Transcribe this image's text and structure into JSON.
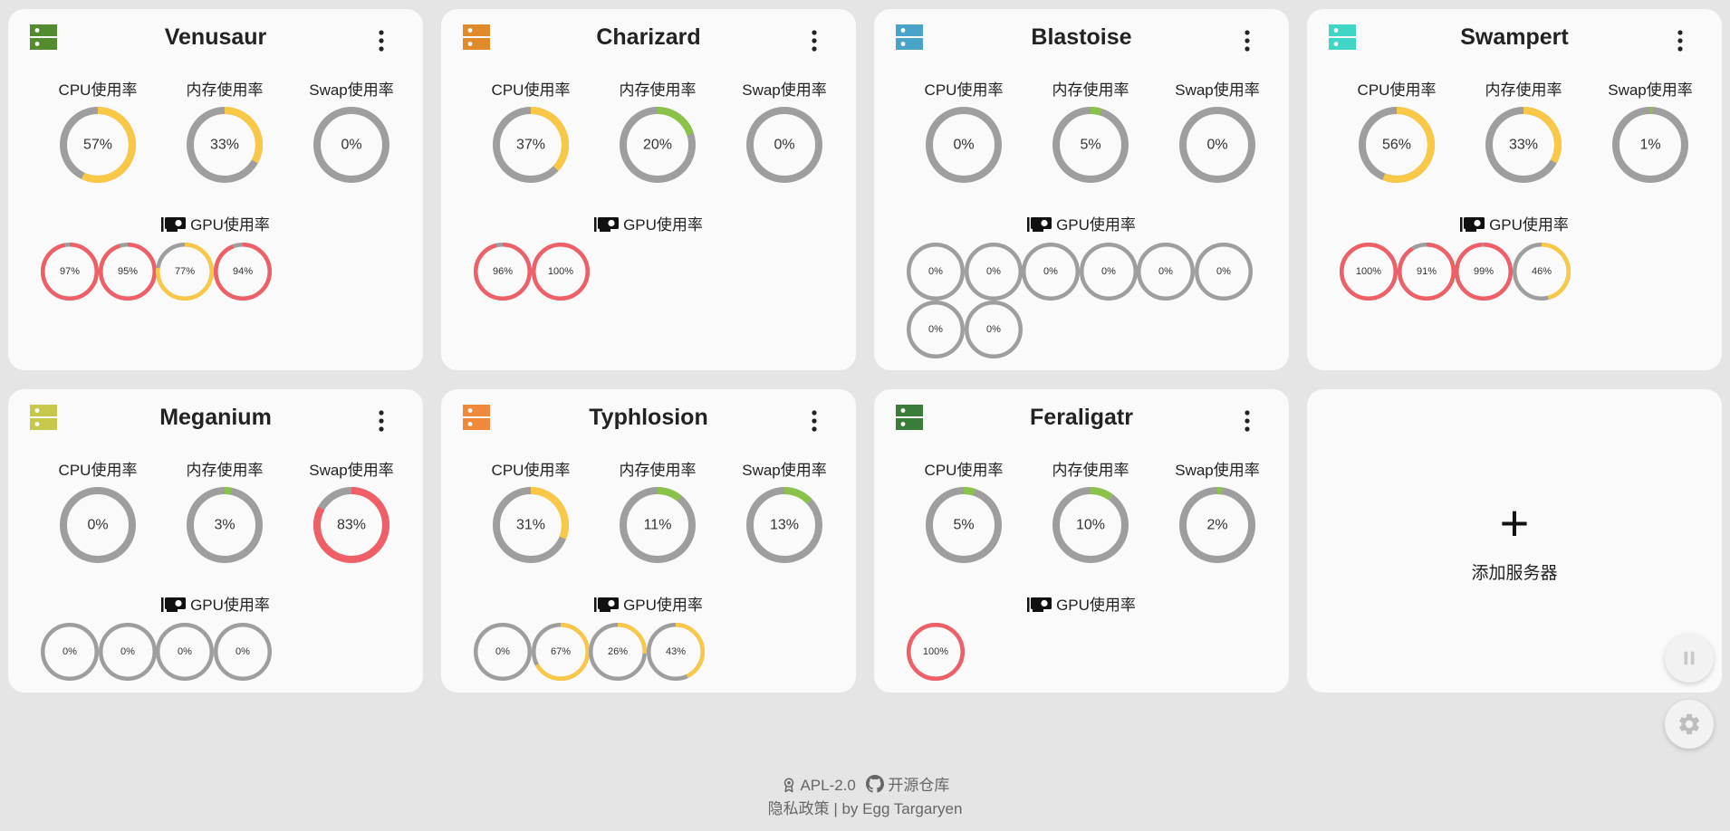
{
  "labels": {
    "cpu": "CPU使用率",
    "mem": "内存使用率",
    "swap": "Swap使用率",
    "gpu": "GPU使用率"
  },
  "colors": {
    "track": "#9e9e9e",
    "low": "#8bc34a",
    "mid": "#f9c846",
    "high": "#ef5f67"
  },
  "servers": [
    {
      "name": "Venusaur",
      "icon": "server-icon",
      "icon_color": "#558b2f",
      "cpu": 57,
      "mem": 33,
      "swap": 0,
      "gpus": [
        97,
        95,
        77,
        94
      ]
    },
    {
      "name": "Charizard",
      "icon": "server-icon",
      "icon_color": "#e08a2a",
      "cpu": 37,
      "mem": 20,
      "swap": 0,
      "gpus": [
        96,
        100
      ]
    },
    {
      "name": "Blastoise",
      "icon": "server-icon",
      "icon_color": "#4aa3c9",
      "cpu": 0,
      "mem": 5,
      "swap": 0,
      "gpus": [
        0,
        0,
        0,
        0,
        0,
        0,
        0,
        0
      ]
    },
    {
      "name": "Swampert",
      "icon": "server-icon",
      "icon_color": "#3fd6c5",
      "cpu": 56,
      "mem": 33,
      "swap": 1,
      "gpus": [
        100,
        91,
        99,
        46
      ]
    },
    {
      "name": "Meganium",
      "icon": "server-icon",
      "icon_color": "#c5c84a",
      "cpu": 0,
      "mem": 3,
      "swap": 83,
      "gpus": [
        0,
        0,
        0,
        0
      ]
    },
    {
      "name": "Typhlosion",
      "icon": "server-icon",
      "icon_color": "#f08a3a",
      "cpu": 31,
      "mem": 11,
      "swap": 13,
      "gpus": [
        0,
        67,
        26,
        43
      ]
    },
    {
      "name": "Feraligatr",
      "icon": "server-icon",
      "icon_color": "#3a7d3a",
      "cpu": 5,
      "mem": 10,
      "swap": 2,
      "gpus": [
        100
      ]
    }
  ],
  "add_server": {
    "plus": "+",
    "label": "添加服务器"
  },
  "fab": {
    "pause": "pause-icon",
    "settings": "gear-icon"
  },
  "footer": {
    "license": "APL-2.0",
    "repo": "开源仓库",
    "privacy": "隐私政策",
    "separator": " | ",
    "author": "by Egg Targaryen"
  }
}
